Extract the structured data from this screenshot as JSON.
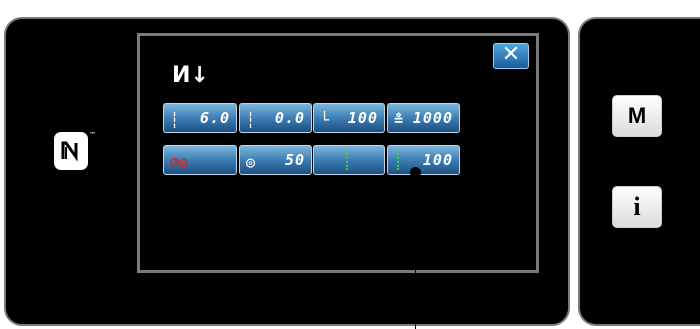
{
  "dialog": {
    "header_icon": "И↓",
    "close_label": "✕"
  },
  "keys_row1": [
    {
      "icon": "stitch-length-icon",
      "value": "6.0"
    },
    {
      "icon": "stitch-width-icon",
      "value": "0.0"
    },
    {
      "icon": "presser-foot-icon",
      "value": "100"
    },
    {
      "icon": "speed-icon",
      "value": "1000"
    }
  ],
  "keys_row2": [
    {
      "icon": "thread-tension-off-icon",
      "value": ""
    },
    {
      "icon": "thread-tension-icon",
      "value": "50"
    },
    {
      "icon": "needle-position-icon",
      "value": ""
    },
    {
      "icon": "needle-position-value-icon",
      "value": "100"
    }
  ],
  "side": {
    "m_label": "M",
    "i_label": "i"
  },
  "colors": {
    "key_blue": "#3d7eb5",
    "needle_green": "#3ad13a",
    "off_red": "#e02020"
  }
}
